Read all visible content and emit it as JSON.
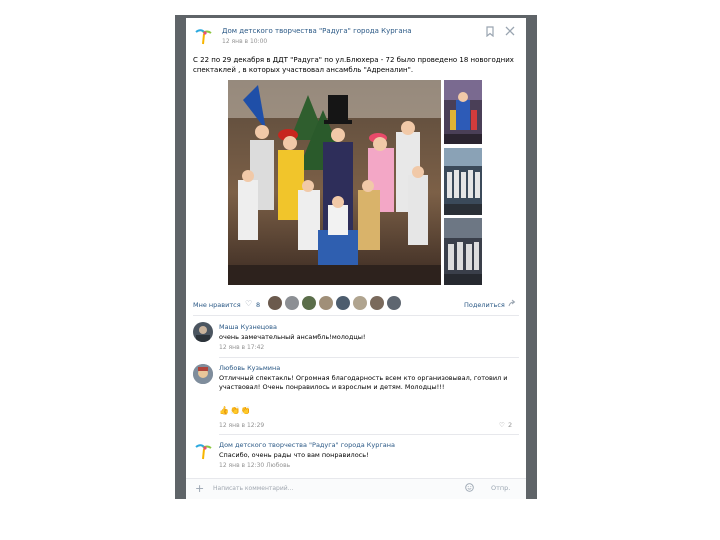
{
  "post": {
    "group_name": "Дом детского творчества \"Радуга\" города Кургана",
    "time": "12 янв в 10:00",
    "text": "С 22 по 29 декабря в ДДТ \"Радуга\" по ул.Блюхера - 72 было проведено 18 новогодних спектаклей , в которых участвовал ансамбль \"Адреналин\".",
    "photos": [
      {
        "icon": "main-photo"
      },
      {
        "icon": "thumbnail-photo"
      },
      {
        "icon": "thumbnail-photo"
      },
      {
        "icon": "thumbnail-photo"
      }
    ],
    "likes_label": "Мне нравится",
    "likes_count": "8",
    "share_label": "Поделиться",
    "header_icons": [
      "bookmark-icon",
      "close-icon"
    ]
  },
  "comments": [
    {
      "author": "Маша Кузнецова",
      "text": "очень замечательный ансамбль!молодцы!",
      "time": "12 янв в 17:42",
      "avatar": "avatar-photo"
    },
    {
      "author": "Любовь Кузьмина",
      "text": "Отличный спектакль! Огромная благодарность всем кто организовывал, готовил и участвовал! Очень понравилось и взрослым и детям. Молодцы!!!",
      "emoji": "👍👏👏",
      "time": "12 янв в 12:29",
      "likes": "2",
      "avatar": "avatar-photo"
    },
    {
      "author": "Дом детского творчества \"Радуга\" города Кургана",
      "text": "Спасибо, очень рады что вам понравилось!",
      "time": "12 янв в 12:30 Любовь",
      "avatar": "group-logo"
    }
  ],
  "reply": {
    "placeholder": "Написать комментарий...",
    "send_label": "Отпр."
  },
  "colors": {
    "link": "#2a5885",
    "muted": "#939393",
    "backdrop": "#5f6468",
    "accent_icon": "#9aa5b1"
  }
}
